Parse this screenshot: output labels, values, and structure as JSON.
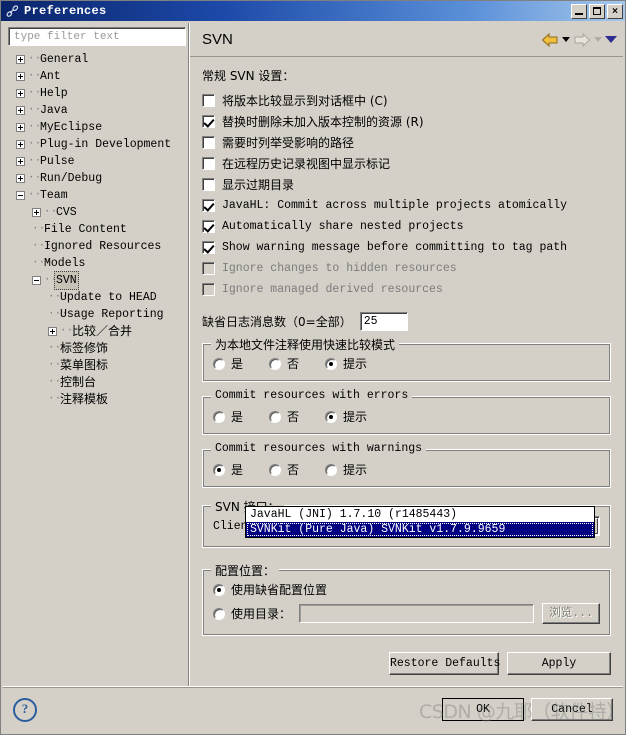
{
  "window": {
    "title": "Preferences",
    "app_icon": "link-icon",
    "minimize_label": "",
    "maximize_label": "",
    "close_label": "×"
  },
  "sidebar": {
    "filter": {
      "value": "",
      "placeholder": "type filter text"
    },
    "tree": [
      {
        "label": "General",
        "indent": 0,
        "twist": "plus",
        "selected": false,
        "cjk": false
      },
      {
        "label": "Ant",
        "indent": 0,
        "twist": "plus",
        "selected": false,
        "cjk": false
      },
      {
        "label": "Help",
        "indent": 0,
        "twist": "plus",
        "selected": false,
        "cjk": false
      },
      {
        "label": "Java",
        "indent": 0,
        "twist": "plus",
        "selected": false,
        "cjk": false
      },
      {
        "label": "MyEclipse",
        "indent": 0,
        "twist": "plus",
        "selected": false,
        "cjk": false
      },
      {
        "label": "Plug-in Development",
        "indent": 0,
        "twist": "plus",
        "selected": false,
        "cjk": false
      },
      {
        "label": "Pulse",
        "indent": 0,
        "twist": "plus",
        "selected": false,
        "cjk": false
      },
      {
        "label": "Run/Debug",
        "indent": 0,
        "twist": "plus",
        "selected": false,
        "cjk": false
      },
      {
        "label": "Team",
        "indent": 0,
        "twist": "minus",
        "selected": false,
        "cjk": false
      },
      {
        "label": "CVS",
        "indent": 1,
        "twist": "plus",
        "selected": false,
        "cjk": false
      },
      {
        "label": "File Content",
        "indent": 1,
        "twist": "none",
        "selected": false,
        "cjk": false
      },
      {
        "label": "Ignored Resources",
        "indent": 1,
        "twist": "none",
        "selected": false,
        "cjk": false
      },
      {
        "label": "Models",
        "indent": 1,
        "twist": "none",
        "selected": false,
        "cjk": false
      },
      {
        "label": "SVN",
        "indent": 1,
        "twist": "minus",
        "selected": true,
        "cjk": false
      },
      {
        "label": "Update to HEAD",
        "indent": 2,
        "twist": "none",
        "selected": false,
        "cjk": false
      },
      {
        "label": "Usage Reporting",
        "indent": 2,
        "twist": "none",
        "selected": false,
        "cjk": false
      },
      {
        "label": "比较／合并",
        "indent": 2,
        "twist": "plus",
        "selected": false,
        "cjk": true
      },
      {
        "label": "标签修饰",
        "indent": 2,
        "twist": "none",
        "selected": false,
        "cjk": true
      },
      {
        "label": "菜单图标",
        "indent": 2,
        "twist": "none",
        "selected": false,
        "cjk": true
      },
      {
        "label": "控制台",
        "indent": 2,
        "twist": "none",
        "selected": false,
        "cjk": true
      },
      {
        "label": "注释模板",
        "indent": 2,
        "twist": "none",
        "selected": false,
        "cjk": true
      }
    ]
  },
  "page": {
    "title": "SVN",
    "nav": {
      "back_icon": "back-arrow-icon",
      "back_menu_icon": "chevron-down-icon",
      "forward_icon": "forward-arrow-icon",
      "forward_menu_icon": "chevron-down-icon",
      "menu_icon": "chevron-down-icon"
    },
    "general_settings_label": "常规 SVN 设置：",
    "checkboxes": [
      {
        "label": "将版本比较显示到对话框中 (C)",
        "checked": false,
        "disabled": false,
        "mono": false
      },
      {
        "label": "替换时删除未加入版本控制的资源 (R)",
        "checked": true,
        "disabled": false,
        "mono": false
      },
      {
        "label": "需要时列举受影响的路径",
        "checked": false,
        "disabled": false,
        "mono": false
      },
      {
        "label": "在远程历史记录视图中显示标记",
        "checked": false,
        "disabled": false,
        "mono": false
      },
      {
        "label": "显示过期目录",
        "checked": false,
        "disabled": false,
        "mono": false
      },
      {
        "label": "JavaHL: Commit across multiple projects atomically",
        "checked": true,
        "disabled": false,
        "mono": true
      },
      {
        "label": "Automatically share nested projects",
        "checked": true,
        "disabled": false,
        "mono": true
      },
      {
        "label": "Show warning message before committing to tag path",
        "checked": true,
        "disabled": false,
        "mono": true
      },
      {
        "label": "Ignore changes to hidden resources",
        "checked": false,
        "disabled": true,
        "mono": true
      },
      {
        "label": "Ignore managed derived resources",
        "checked": false,
        "disabled": true,
        "mono": true
      }
    ],
    "log_messages": {
      "label": "缺省日志消息数（0=全部）",
      "value": "25"
    },
    "radio_groups": [
      {
        "title": "为本地文件注释使用快速比较模式",
        "title_mono": false,
        "options": [
          {
            "label": "是",
            "selected": false
          },
          {
            "label": "否",
            "selected": false
          },
          {
            "label": "提示",
            "selected": true
          }
        ]
      },
      {
        "title": "Commit resources with errors",
        "title_mono": true,
        "options": [
          {
            "label": "是",
            "selected": false
          },
          {
            "label": "否",
            "selected": false
          },
          {
            "label": "提示",
            "selected": true
          }
        ]
      },
      {
        "title": "Commit resources with warnings",
        "title_mono": true,
        "options": [
          {
            "label": "是",
            "selected": true
          },
          {
            "label": "否",
            "selected": false
          },
          {
            "label": "提示",
            "selected": false
          }
        ]
      }
    ],
    "svn_interface": {
      "title": "SVN 接口：",
      "client_label": "Client:",
      "client_value": "SVNKit (Pure Java) SVNKit v1.7.9.9659",
      "dropdown_open": true,
      "options": [
        {
          "label": "JavaHL (JNI) 1.7.10 (r1485443)",
          "selected": false
        },
        {
          "label": "SVNKit (Pure Java) SVNKit v1.7.9.9659",
          "selected": true
        }
      ]
    },
    "config_location": {
      "title": "配置位置：",
      "options": [
        {
          "label": "使用缺省配置位置",
          "selected": true
        },
        {
          "label": "使用目录：",
          "selected": false
        }
      ],
      "dir_value": "",
      "browse_label": "浏览...",
      "browse_disabled": true
    },
    "actions": {
      "restore_defaults": "Restore Defaults",
      "apply": "Apply"
    }
  },
  "footer": {
    "help_icon": "help-question-icon",
    "ok_label": "OK",
    "cancel_label": "Cancel"
  },
  "watermark": {
    "text": "CSDN @九耶（软件特）"
  },
  "colors": {
    "face": "#d4d0c8",
    "title_start": "#0a246a",
    "title_end": "#a6c8ec",
    "select_blue": "#000080",
    "back_arrow": "#e0a93b"
  }
}
